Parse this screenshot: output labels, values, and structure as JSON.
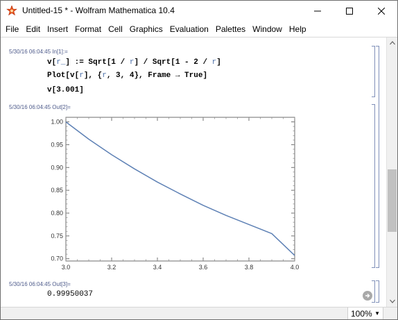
{
  "window": {
    "title": "Untitled-15 * - Wolfram Mathematica 10.4"
  },
  "menu": {
    "items": [
      "File",
      "Edit",
      "Insert",
      "Format",
      "Cell",
      "Graphics",
      "Evaluation",
      "Palettes",
      "Window",
      "Help"
    ]
  },
  "cells": {
    "input1": {
      "label": "5/30/16 06:04:45 In[1]:=",
      "lines": [
        [
          "v[",
          "r_",
          "] := Sqrt[1 / ",
          "r",
          "] / Sqrt[1 - 2 / ",
          "r",
          "]"
        ],
        [
          "Plot[v[",
          "r",
          "], {",
          "r",
          ", 3, 4}, Frame → True]"
        ],
        [
          "v[3.001]"
        ]
      ]
    },
    "output2": {
      "label": "5/30/16 06:04:45 Out[2]="
    },
    "output3": {
      "label": "5/30/16 06:04:45 Out[3]=",
      "value": "0.99950037"
    }
  },
  "chart_data": {
    "type": "line",
    "title": "",
    "xlabel": "",
    "ylabel": "",
    "xlim": [
      3.0,
      4.0
    ],
    "ylim": [
      0.695,
      1.01
    ],
    "x_ticks": [
      "3.0",
      "3.2",
      "3.4",
      "3.6",
      "3.8",
      "4.0"
    ],
    "y_ticks": [
      "0.70",
      "0.75",
      "0.80",
      "0.85",
      "0.90",
      "0.95",
      "1.00"
    ],
    "grid": false,
    "frame": true,
    "series": [
      {
        "x": [
          3.0,
          3.1,
          3.2,
          3.3,
          3.4,
          3.5,
          3.6,
          3.7,
          3.8,
          3.9,
          4.0
        ],
        "values": [
          1.0,
          0.962,
          0.928,
          0.897,
          0.868,
          0.842,
          0.817,
          0.795,
          0.775,
          0.755,
          0.707
        ],
        "color": "#5e81b5"
      }
    ]
  },
  "status": {
    "zoom": "100%"
  },
  "colors": {
    "cell_label": "#4d5a8a",
    "variable": "#4b6fa8",
    "bracket": "#7f8fb8",
    "plot_line": "#5e81b5"
  }
}
